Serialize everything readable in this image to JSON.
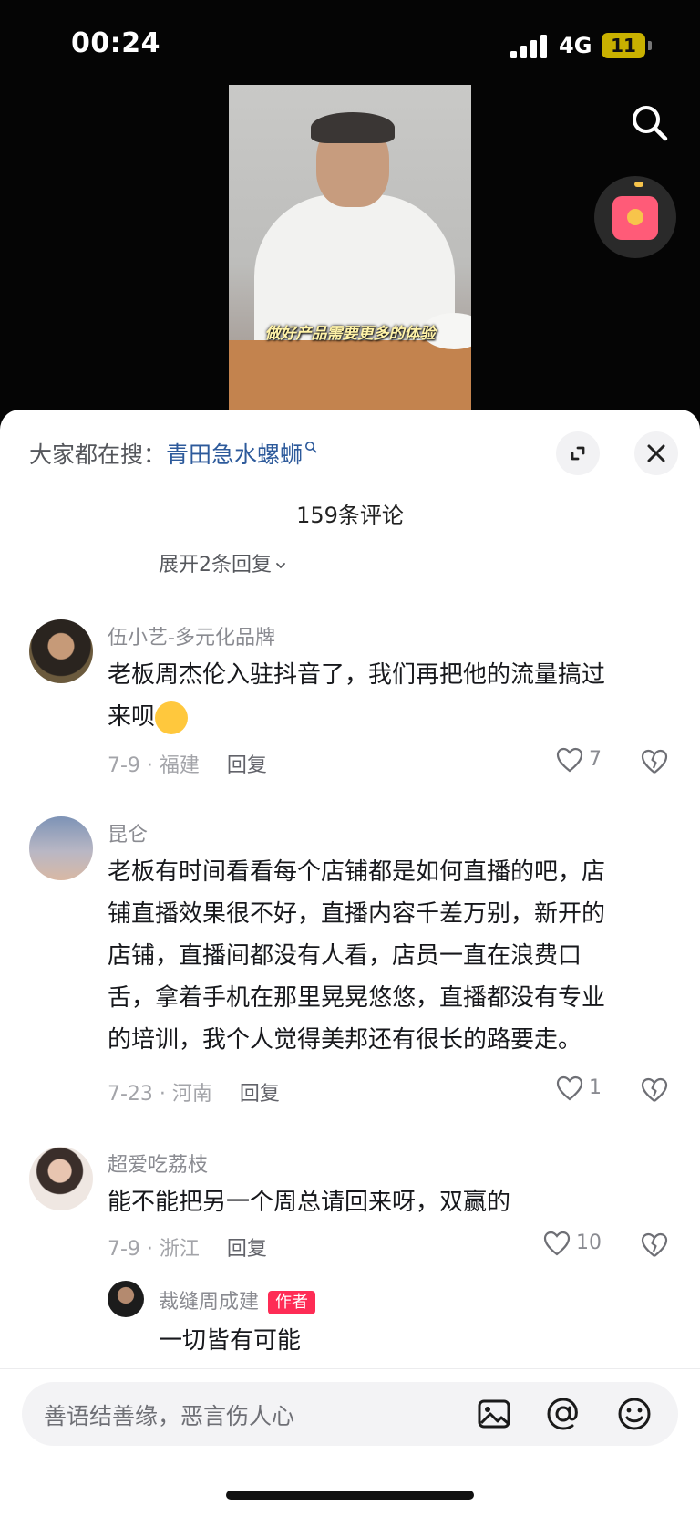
{
  "status_bar": {
    "time": "00:24",
    "network": "4G",
    "battery": "11"
  },
  "video": {
    "caption": "做好产品需要更多的体验"
  },
  "sheet": {
    "hot_search_prefix": "大家都在搜：",
    "hot_search_term": "青田急水螺蛳",
    "comment_count": "159条评论",
    "expand_replies": "展开2条回复"
  },
  "comments": [
    {
      "username": "伍小艺-多元化品牌",
      "text_lines": [
        "老板周杰伦入驻抖音了，我们再把他的流量搞过",
        "来呗"
      ],
      "date_location": "7-9 · 福建",
      "reply_label": "回复",
      "likes": "7"
    },
    {
      "username": "昆仑",
      "text_lines": [
        "老板有时间看看每个店铺都是如何直播的吧，店",
        "铺直播效果很不好，直播内容千差万别，新开的",
        "店铺，直播间都没有人看，店员一直在浪费口",
        "舌，拿着手机在那里晃晃悠悠，直播都没有专业",
        "的培训，我个人觉得美邦还有很长的路要走。"
      ],
      "date_location": "7-23 · 河南",
      "reply_label": "回复",
      "likes": "1"
    },
    {
      "username": "超爱吃荔枝",
      "text_lines": [
        "能不能把另一个周总请回来呀，双赢的"
      ],
      "date_location": "7-9 · 浙江",
      "reply_label": "回复",
      "likes": "10",
      "reply": {
        "username": "裁缝周成建",
        "badge": "作者",
        "text": "一切皆有可能"
      }
    }
  ],
  "input": {
    "placeholder": "善语结善缘，恶言伤人心"
  },
  "icons": {
    "search": "search-icon",
    "expand": "expand-icon",
    "close": "close-icon",
    "heart": "heart-icon",
    "dislike": "broken-heart-icon",
    "image": "image-icon",
    "at": "at-icon",
    "emoji": "emoji-icon"
  },
  "colors": {
    "accent_link": "#2d5a9b",
    "author_badge": "#fe2c55"
  }
}
